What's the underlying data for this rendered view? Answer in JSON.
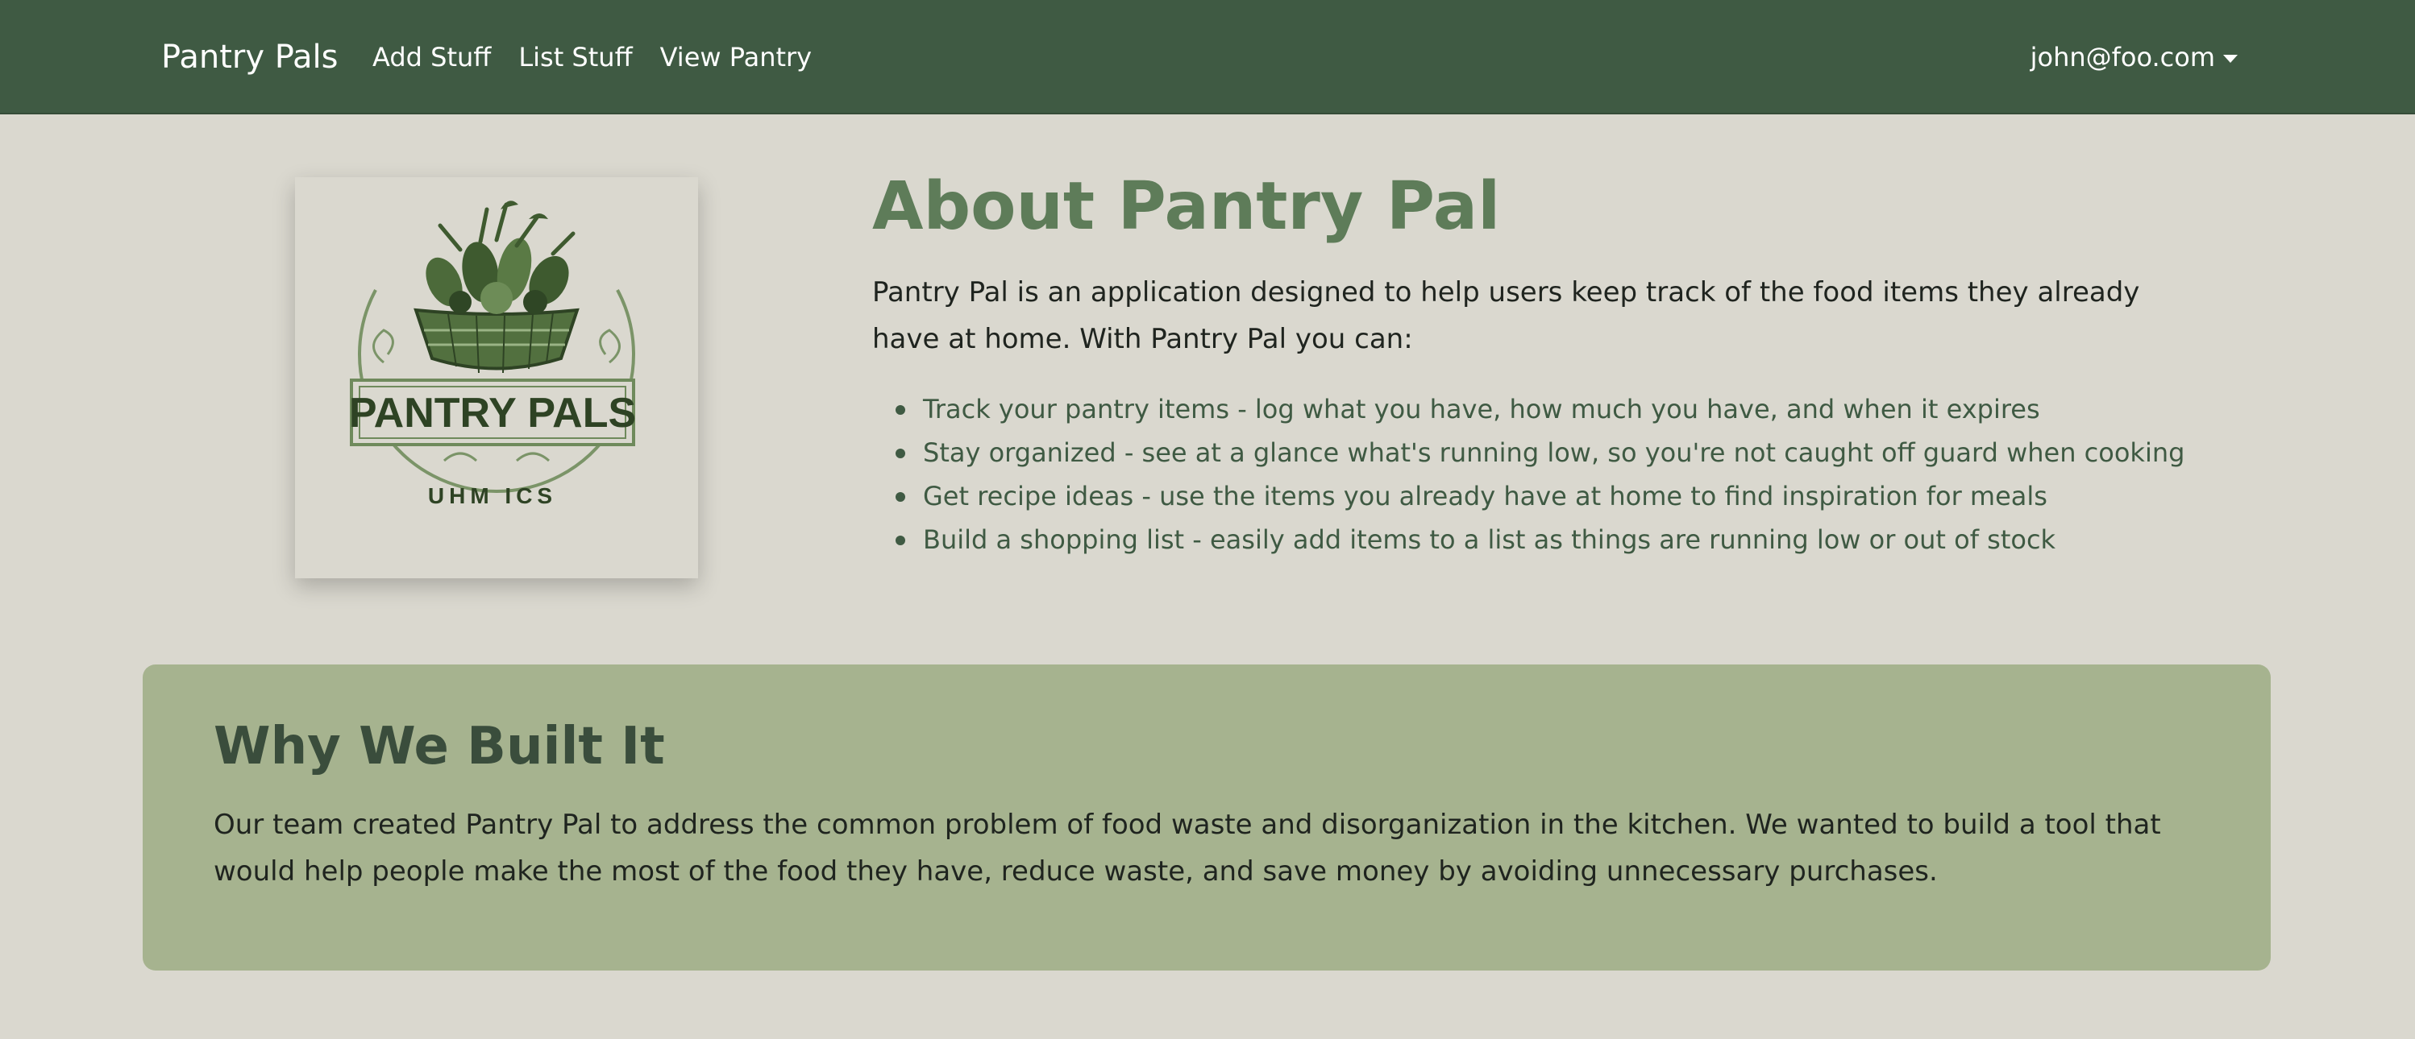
{
  "navbar": {
    "brand": "Pantry Pals",
    "links": [
      "Add Stuff",
      "List Stuff",
      "View Pantry"
    ],
    "user_email": "john@foo.com",
    "user_menu_icon": "caret-down-icon"
  },
  "logo": {
    "icon": "basket-of-vegetables-logo",
    "text": "PANTRY PALS",
    "subtext": "UHM ICS"
  },
  "about": {
    "title": "About Pantry Pal",
    "intro": "Pantry Pal is an application designed to help users keep track of the food items they already have at home. With Pantry Pal you can:",
    "features": [
      "Track your pantry items - log what you have, how much you have, and when it expires",
      "Stay organized - see at a glance what's running low, so you're not caught off guard when cooking",
      "Get recipe ideas - use the items you already have at home to find inspiration for meals",
      "Build a shopping list - easily add items to a list as things are running low or out of stock"
    ]
  },
  "why": {
    "title": "Why We Built It",
    "text": "Our team created Pantry Pal to address the common problem of food waste and disorganization in the kitchen. We wanted to build a tool that would help people make the most of the food they have, reduce waste, and save money by avoiding unnecessary purchases."
  },
  "colors": {
    "navbar_bg": "#3f5a43",
    "page_bg": "#dad8cf",
    "title_green": "#5e7c59",
    "panel_bg": "#a6b38f",
    "list_text": "#3f5a43"
  }
}
